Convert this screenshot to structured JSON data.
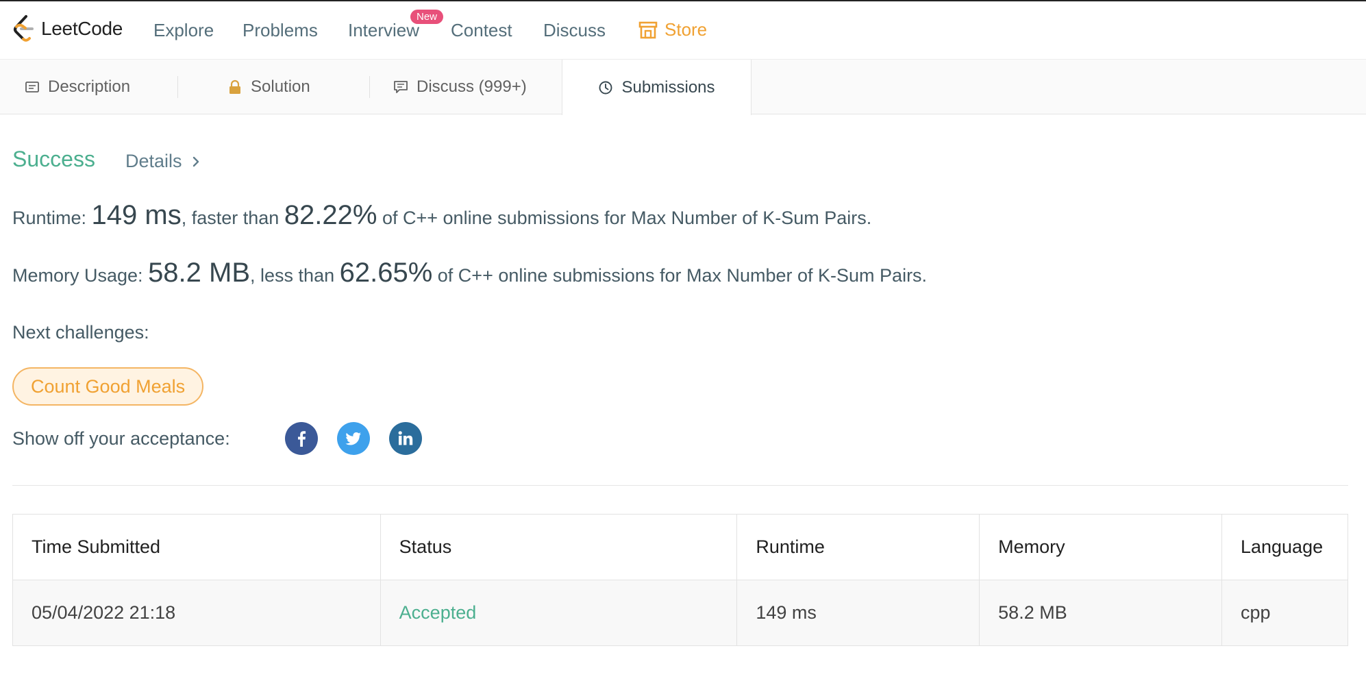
{
  "brand": {
    "logo_text": "LeetCode"
  },
  "nav": {
    "items": [
      {
        "label": "Explore"
      },
      {
        "label": "Problems"
      },
      {
        "label": "Interview"
      },
      {
        "label": "Contest"
      },
      {
        "label": "Discuss"
      },
      {
        "label": "Store"
      }
    ],
    "new_badge": "New",
    "store_color": "#f0a132"
  },
  "tabs": [
    {
      "label": "Description",
      "icon": "description-icon"
    },
    {
      "label": "Solution",
      "icon": "lock-icon"
    },
    {
      "label": "Discuss (999+)",
      "icon": "comment-icon"
    },
    {
      "label": "Submissions",
      "icon": "clock-icon",
      "active": true
    }
  ],
  "result": {
    "status": "Success",
    "details_label": "Details",
    "runtime": {
      "prefix": "Runtime: ",
      "value": "149 ms",
      "middle": ", faster than ",
      "percent": "82.22%",
      "suffix": " of C++ online submissions for Max Number of K-Sum Pairs."
    },
    "memory": {
      "prefix": "Memory Usage: ",
      "value": "58.2 MB",
      "middle": ", less than ",
      "percent": "62.65%",
      "suffix": " of C++ online submissions for Max Number of K-Sum Pairs."
    },
    "next_challenges_label": "Next challenges:",
    "next_challenges": [
      "Count Good Meals"
    ],
    "share_label": "Show off your acceptance:",
    "share_icons": [
      "facebook-icon",
      "twitter-icon",
      "linkedin-icon"
    ]
  },
  "table": {
    "headers": [
      "Time Submitted",
      "Status",
      "Runtime",
      "Memory",
      "Language"
    ],
    "rows": [
      [
        "05/04/2022 21:18",
        "Accepted",
        "149 ms",
        "58.2 MB",
        "cpp"
      ]
    ]
  },
  "colors": {
    "success": "#4caf8f",
    "accent": "#f0a132",
    "facebook": "#3b5998",
    "twitter": "#3ea1ec",
    "linkedin": "#2b6d9c"
  }
}
